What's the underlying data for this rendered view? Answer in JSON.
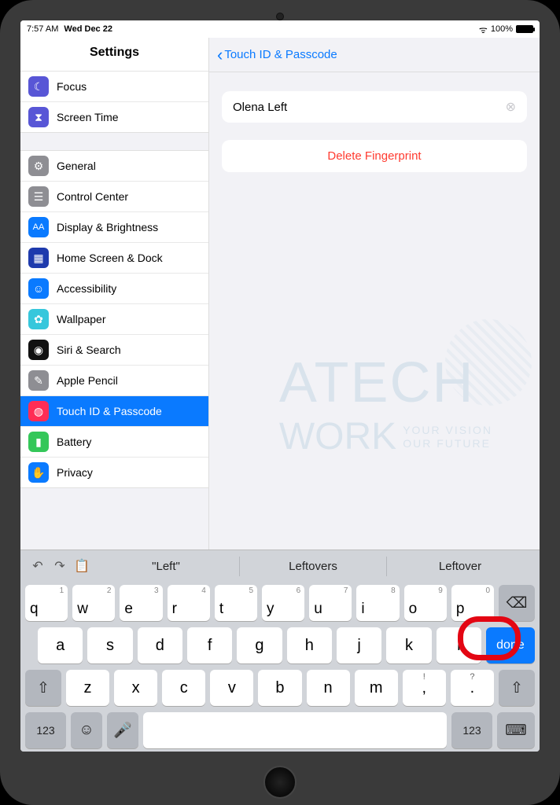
{
  "status": {
    "time": "7:57 AM",
    "date": "Wed Dec 22",
    "battery": "100%"
  },
  "sidebar": {
    "title": "Settings",
    "g1": [
      {
        "label": "Focus"
      },
      {
        "label": "Screen Time"
      }
    ],
    "g2": [
      {
        "label": "General"
      },
      {
        "label": "Control Center"
      },
      {
        "label": "Display & Brightness"
      },
      {
        "label": "Home Screen & Dock"
      },
      {
        "label": "Accessibility"
      },
      {
        "label": "Wallpaper"
      },
      {
        "label": "Siri & Search"
      },
      {
        "label": "Apple Pencil"
      },
      {
        "label": "Touch ID & Passcode"
      },
      {
        "label": "Battery"
      },
      {
        "label": "Privacy"
      }
    ]
  },
  "detail": {
    "back": "Touch ID & Passcode",
    "name_value": "Olena Left",
    "delete": "Delete Fingerprint"
  },
  "kbd": {
    "sugg": [
      "\"Left\"",
      "Leftovers",
      "Leftover"
    ],
    "r1": [
      {
        "k": "q",
        "n": "1"
      },
      {
        "k": "w",
        "n": "2"
      },
      {
        "k": "e",
        "n": "3"
      },
      {
        "k": "r",
        "n": "4"
      },
      {
        "k": "t",
        "n": "5"
      },
      {
        "k": "y",
        "n": "6"
      },
      {
        "k": "u",
        "n": "7"
      },
      {
        "k": "i",
        "n": "8"
      },
      {
        "k": "o",
        "n": "9"
      },
      {
        "k": "p",
        "n": "0"
      }
    ],
    "r2": [
      "a",
      "s",
      "d",
      "f",
      "g",
      "h",
      "j",
      "k",
      "l"
    ],
    "r3": [
      "z",
      "x",
      "c",
      "v",
      "b",
      "n",
      "m"
    ],
    "punct": [
      {
        "main": ",",
        "sub": "!"
      },
      {
        "main": ".",
        "sub": "?"
      }
    ],
    "done": "done",
    "numkey": "123"
  },
  "watermark": {
    "l1": "ATECH",
    "l2": "WORK",
    "s1": "YOUR VISION",
    "s2": "OUR FUTURE"
  }
}
